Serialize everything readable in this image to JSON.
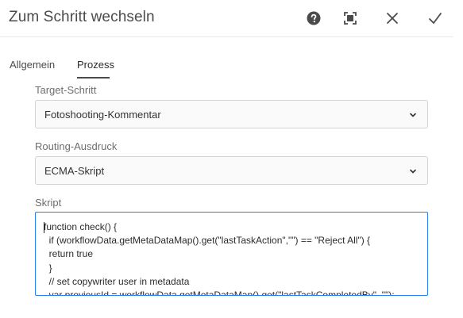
{
  "header": {
    "title": "Zum Schritt wechseln",
    "icons": [
      "help-icon",
      "fullscreen-icon",
      "close-icon",
      "checkmark-icon"
    ]
  },
  "tabs": [
    {
      "label": "Allgemein",
      "active": false
    },
    {
      "label": "Prozess",
      "active": true
    }
  ],
  "form": {
    "target_label": "Target-Schritt",
    "target_value": "Fotoshooting-Kommentar",
    "routing_label": "Routing-Ausdruck",
    "routing_value": "ECMA-Skript",
    "script_label": "Skript",
    "script_lines": [
      "function check() {",
      "  if (workflowData.getMetaDataMap().get(\"lastTaskAction\",\"\") == \"Reject All\") {",
      "  return true",
      "  }",
      "  // set copywriter user in metadata",
      "  var previousId = workflowData.getMetaDataMap().get(\"lastTaskCompletedBy\", \"\");"
    ]
  },
  "colors": {
    "accent": "#2680eb",
    "text": "#323232",
    "label": "#6e6e6e"
  }
}
